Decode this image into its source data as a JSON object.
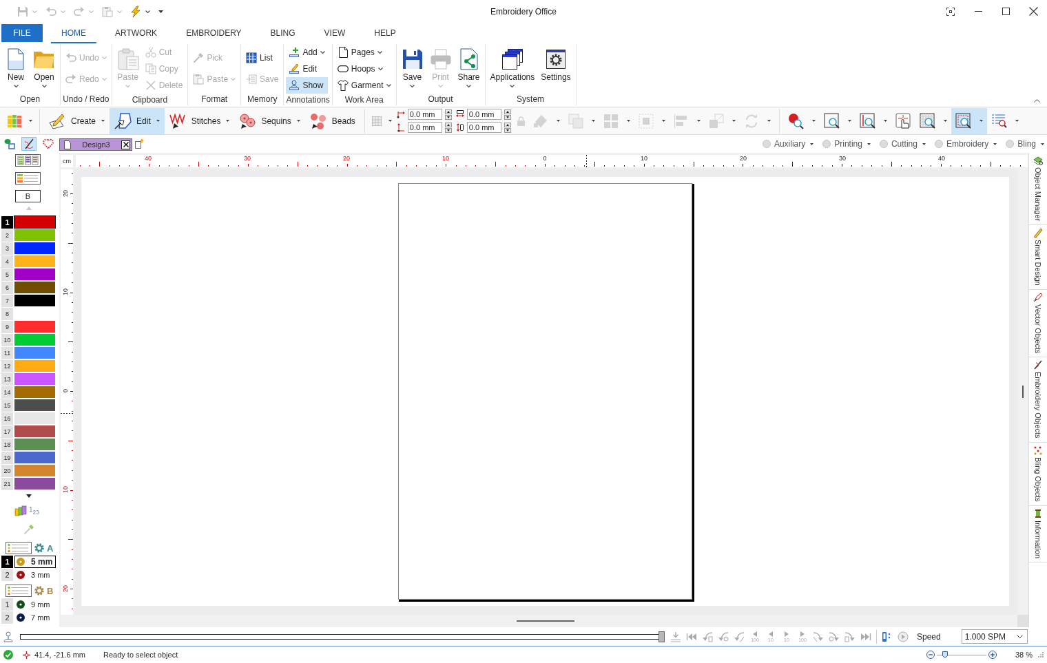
{
  "window": {
    "title": "Embroidery Office"
  },
  "quick_access": [
    {
      "kind": "save",
      "disabled": true,
      "dropdown": true
    },
    {
      "kind": "undo",
      "disabled": true,
      "dropdown": true
    },
    {
      "kind": "redo",
      "disabled": true,
      "dropdown": true
    },
    {
      "kind": "paste",
      "disabled": true,
      "dropdown": true
    },
    {
      "kind": "flash",
      "disabled": false,
      "dropdown": true
    }
  ],
  "ribbon": {
    "file_tab": "FILE",
    "tabs": [
      {
        "label": "HOME",
        "selected": true
      },
      {
        "label": "ARTWORK",
        "selected": false
      },
      {
        "label": "EMBROIDERY",
        "selected": false
      },
      {
        "label": "BLING",
        "selected": false
      },
      {
        "label": "VIEW",
        "selected": false
      },
      {
        "label": "HELP",
        "selected": false
      }
    ],
    "groups": [
      {
        "label": "Open",
        "items": [
          {
            "label": "New",
            "kind": "large",
            "dropdown": true,
            "disabled": false
          },
          {
            "label": "Open",
            "kind": "large",
            "dropdown": true,
            "disabled": false
          }
        ]
      },
      {
        "label": "Undo / Redo",
        "items": [
          {
            "label": "Undo",
            "kind": "small",
            "dropdown": true,
            "disabled": true
          },
          {
            "label": "Redo",
            "kind": "small",
            "dropdown": true,
            "disabled": true
          }
        ]
      },
      {
        "label": "Clipboard",
        "items": [
          {
            "label": "Paste",
            "kind": "large",
            "dropdown": true,
            "disabled": true
          },
          {
            "label": "Cut",
            "kind": "small",
            "dropdown": false,
            "disabled": true
          },
          {
            "label": "Copy",
            "kind": "small",
            "dropdown": false,
            "disabled": true
          },
          {
            "label": "Delete",
            "kind": "small",
            "dropdown": false,
            "disabled": true
          }
        ]
      },
      {
        "label": "Format",
        "items": [
          {
            "label": "Pick",
            "kind": "small",
            "dropdown": false,
            "disabled": true
          },
          {
            "label": "Paste",
            "kind": "small",
            "dropdown": true,
            "disabled": true
          }
        ]
      },
      {
        "label": "Memory",
        "items": [
          {
            "label": "List",
            "kind": "small",
            "dropdown": false,
            "disabled": false
          },
          {
            "label": "Save",
            "kind": "small",
            "dropdown": false,
            "disabled": true
          }
        ]
      },
      {
        "label": "Annotations",
        "items": [
          {
            "label": "Add",
            "kind": "small",
            "dropdown": true,
            "disabled": false,
            "on": false
          },
          {
            "label": "Edit",
            "kind": "small",
            "dropdown": false,
            "disabled": false,
            "on": false
          },
          {
            "label": "Show",
            "kind": "small",
            "dropdown": false,
            "disabled": false,
            "on": true
          }
        ]
      },
      {
        "label": "Work Area",
        "items": [
          {
            "label": "Pages",
            "kind": "small",
            "dropdown": true,
            "disabled": false
          },
          {
            "label": "Hoops",
            "kind": "small",
            "dropdown": true,
            "disabled": false
          },
          {
            "label": "Garment",
            "kind": "small",
            "dropdown": true,
            "disabled": false
          }
        ]
      },
      {
        "label": "Output",
        "items": [
          {
            "label": "Save",
            "kind": "large",
            "dropdown": true,
            "disabled": false
          },
          {
            "label": "Print",
            "kind": "large",
            "dropdown": true,
            "disabled": true
          },
          {
            "label": "Share",
            "kind": "large",
            "dropdown": true,
            "disabled": false
          }
        ]
      },
      {
        "label": "System",
        "items": [
          {
            "label": "Applications",
            "kind": "large",
            "dropdown": true,
            "disabled": false
          },
          {
            "label": "Settings",
            "kind": "large",
            "dropdown": false,
            "disabled": false
          }
        ]
      }
    ]
  },
  "toolbar": {
    "modes": [
      {
        "label": "Create",
        "dropdown": true,
        "selected": false
      },
      {
        "label": "Edit",
        "dropdown": true,
        "selected": true
      },
      {
        "label": "Stitches",
        "dropdown": true,
        "selected": false
      },
      {
        "label": "Sequins",
        "dropdown": true,
        "selected": false
      },
      {
        "label": "Beads",
        "dropdown": false,
        "selected": false
      }
    ],
    "grid_tool": {
      "disabled": true
    },
    "position_fields": [
      {
        "kind": "x",
        "value": "0.0 mm"
      },
      {
        "kind": "y",
        "value": "0.0 mm"
      }
    ],
    "size_fields": [
      {
        "kind": "width",
        "value": "0.0 mm"
      },
      {
        "kind": "height",
        "value": "0.0 mm"
      }
    ],
    "lock_tool": {
      "disabled": true
    },
    "arrange_tools": [
      {
        "disabled": true
      },
      {
        "disabled": true
      },
      {
        "disabled": true
      },
      {
        "disabled": true
      },
      {
        "disabled": true
      },
      {
        "disabled": true
      },
      {
        "disabled": true
      }
    ],
    "zoom_tools": [
      {
        "selected": false,
        "dropdown": true
      },
      {
        "selected": false,
        "dropdown": true
      },
      {
        "selected": false,
        "dropdown": true
      },
      {
        "selected": false,
        "dropdown": false
      },
      {
        "selected": false,
        "dropdown": true
      },
      {
        "selected": true,
        "dropdown": true
      },
      {
        "selected": false,
        "dropdown": true
      }
    ]
  },
  "view_modes": [
    {
      "selected": false
    },
    {
      "selected": true
    },
    {
      "selected": false
    }
  ],
  "document_tabs": [
    {
      "label": "Design3",
      "selected": true
    }
  ],
  "layers": [
    {
      "label": "Auxiliary",
      "checked": false
    },
    {
      "label": "Printing",
      "checked": false
    },
    {
      "label": "Cutting",
      "checked": false
    },
    {
      "label": "Embroidery",
      "checked": false
    },
    {
      "label": "Bling",
      "checked": false
    }
  ],
  "horizontal_ruler": {
    "unit": "cm",
    "labels": [
      {
        "text": "40",
        "negative": true
      },
      {
        "text": "30",
        "negative": true
      },
      {
        "text": "20",
        "negative": true
      },
      {
        "text": "10",
        "negative": true
      },
      {
        "text": "0",
        "negative": false
      },
      {
        "text": "10",
        "negative": false
      },
      {
        "text": "20",
        "negative": false
      },
      {
        "text": "30",
        "negative": false
      },
      {
        "text": "40",
        "negative": false
      }
    ]
  },
  "vertical_ruler": {
    "labels": [
      {
        "text": "20",
        "negative": false
      },
      {
        "text": "10",
        "negative": false
      },
      {
        "text": "0",
        "negative": false
      },
      {
        "text": "10",
        "negative": true
      },
      {
        "text": "20",
        "negative": true
      }
    ]
  },
  "palette": {
    "group_button": "B",
    "sort_label": "1$_{2}$$_{3}$"
  },
  "threads": [
    {
      "number": "1",
      "color": "#d40000",
      "selected": true
    },
    {
      "number": "2",
      "color": "#7fc300",
      "selected": false
    },
    {
      "number": "3",
      "color": "#0026ff",
      "selected": false
    },
    {
      "number": "4",
      "color": "#ffb21a",
      "selected": false
    },
    {
      "number": "5",
      "color": "#a100c7",
      "selected": false
    },
    {
      "number": "6",
      "color": "#714d00",
      "selected": false
    },
    {
      "number": "7",
      "color": "#000000",
      "selected": false
    },
    {
      "number": "8",
      "selected": false
    },
    {
      "number": "9",
      "color": "#ff2e2e",
      "selected": false
    },
    {
      "number": "10",
      "color": "#00cc33",
      "selected": false
    },
    {
      "number": "11",
      "color": "#4287ff",
      "selected": false
    },
    {
      "number": "12",
      "color": "#ffab13",
      "selected": false
    },
    {
      "number": "13",
      "color": "#cc55ff",
      "selected": false
    },
    {
      "number": "14",
      "color": "#a56a00",
      "selected": false
    },
    {
      "number": "15",
      "color": "#4d4d4d",
      "selected": false
    },
    {
      "number": "16",
      "color": "#e6e6e6",
      "selected": false
    },
    {
      "number": "17",
      "color": "#b04b4b",
      "selected": false
    },
    {
      "number": "18",
      "color": "#5b8f52",
      "selected": false
    },
    {
      "number": "19",
      "color": "#4d68cc",
      "selected": false
    },
    {
      "number": "20",
      "color": "#d4862e",
      "selected": false
    },
    {
      "number": "21",
      "color": "#8b4a9e",
      "selected": false
    }
  ],
  "bling_groups": [
    {
      "label": "A",
      "color": "#3a8a8c",
      "items": [
        {
          "number": "1",
          "size": "5 mm",
          "color": "#c89b1a",
          "selected": true
        },
        {
          "number": "2",
          "size": "3 mm",
          "color": "#a01010",
          "selected": false
        }
      ]
    },
    {
      "label": "B",
      "color": "#a8884e",
      "items": [
        {
          "number": "1",
          "size": "9 mm",
          "color": "#0f4d1a",
          "selected": false
        },
        {
          "number": "2",
          "size": "7 mm",
          "color": "#0d1a4d",
          "selected": false
        }
      ]
    }
  ],
  "side_panels": [
    {
      "label": "Object Manager"
    },
    {
      "label": "Smart Design"
    },
    {
      "label": "Vector Objects"
    },
    {
      "label": "Embroidery Objects"
    },
    {
      "label": "Bling Objects"
    },
    {
      "label": "Information"
    }
  ],
  "player": {
    "progress": {
      "level": 1
    },
    "controls": [
      {
        "kind": "trace"
      },
      {
        "kind": "first"
      },
      {
        "kind": "color_back"
      },
      {
        "kind": "object_back"
      },
      {
        "kind": "stop_back"
      },
      {
        "kind": "step_back",
        "caption": "100"
      },
      {
        "kind": "step_back",
        "caption": "10"
      },
      {
        "kind": "step_forward",
        "caption": "10"
      },
      {
        "kind": "step_forward",
        "caption": "100"
      },
      {
        "kind": "stop_forward"
      },
      {
        "kind": "object_forward"
      },
      {
        "kind": "color_forward"
      },
      {
        "kind": "last"
      },
      {
        "kind": "simulator"
      },
      {
        "kind": "play"
      }
    ],
    "speed_label": "Speed",
    "speed": "1.000 SPM"
  },
  "status_bar": {
    "coordinates": "41.4, -21.6 mm",
    "message": "Ready to select object",
    "zoom_slider": {
      "level": 0.12
    },
    "zoom": "38 %"
  }
}
